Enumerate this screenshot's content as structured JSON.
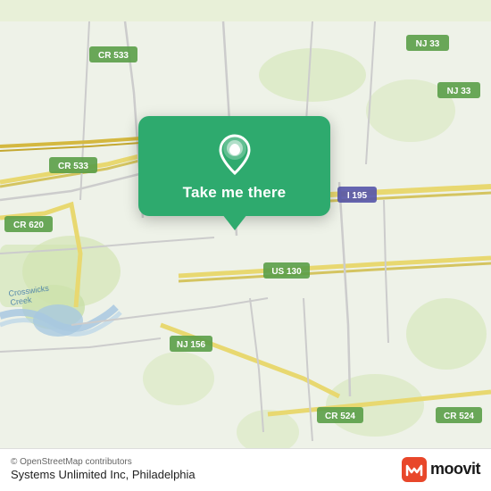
{
  "map": {
    "background_color": "#eef2e8",
    "alt": "Map of Systems Unlimited Inc, Philadelphia area"
  },
  "popup": {
    "button_label": "Take me there",
    "bg_color": "#2eaa6e",
    "pin_icon": "location-pin-icon"
  },
  "bottom_bar": {
    "osm_credit": "© OpenStreetMap contributors",
    "location_label": "Systems Unlimited Inc, Philadelphia",
    "moovit_text": "moovit"
  },
  "road_labels": [
    {
      "id": "cr533_top",
      "text": "CR 533"
    },
    {
      "id": "nj33_top",
      "text": "NJ 33"
    },
    {
      "id": "cr533_left",
      "text": "CR 533"
    },
    {
      "id": "cr620",
      "text": "CR 620"
    },
    {
      "id": "i195",
      "text": "I 195"
    },
    {
      "id": "us130",
      "text": "US 130"
    },
    {
      "id": "nj156",
      "text": "NJ 156"
    },
    {
      "id": "cr524",
      "text": "CR 524"
    },
    {
      "id": "cr524_right",
      "text": "CR 524"
    },
    {
      "id": "crosswicks",
      "text": "Crosswicks Creek"
    }
  ]
}
